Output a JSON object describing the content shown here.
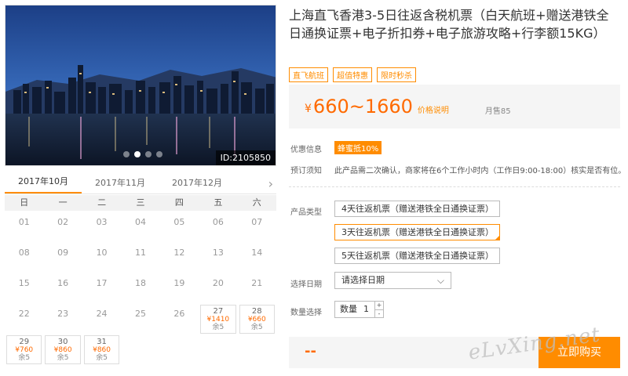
{
  "gallery": {
    "photo_id": "ID:2105850",
    "dots": [
      false,
      true,
      false,
      false
    ]
  },
  "calendar": {
    "months": [
      "2017年10月",
      "2017年11月",
      "2017年12月"
    ],
    "active_month": 0,
    "weekdays": [
      "日",
      "一",
      "二",
      "三",
      "四",
      "五",
      "六"
    ],
    "days": [
      {
        "day": "01"
      },
      {
        "day": "02"
      },
      {
        "day": "03"
      },
      {
        "day": "04"
      },
      {
        "day": "05"
      },
      {
        "day": "06"
      },
      {
        "day": "07"
      },
      {
        "day": "08"
      },
      {
        "day": "09"
      },
      {
        "day": "10"
      },
      {
        "day": "11"
      },
      {
        "day": "12"
      },
      {
        "day": "13"
      },
      {
        "day": "14"
      },
      {
        "day": "15"
      },
      {
        "day": "16"
      },
      {
        "day": "17"
      },
      {
        "day": "18"
      },
      {
        "day": "19"
      },
      {
        "day": "20"
      },
      {
        "day": "21"
      },
      {
        "day": "22"
      },
      {
        "day": "23"
      },
      {
        "day": "24"
      },
      {
        "day": "25"
      },
      {
        "day": "26"
      },
      {
        "day": "27",
        "price": "¥1410",
        "stock": "余5"
      },
      {
        "day": "28",
        "price": "¥660",
        "stock": "余5"
      },
      {
        "day": "29",
        "price": "¥760",
        "stock": "余5"
      },
      {
        "day": "30",
        "price": "¥860",
        "stock": "余5"
      },
      {
        "day": "31",
        "price": "¥860",
        "stock": "余5"
      }
    ]
  },
  "product": {
    "title": "上海直飞香港3-5日往返含税机票（白天航班+赠送港铁全日通换证票+电子折扣券+电子旅游攻略+行李额15KG）",
    "tags": [
      "直飞航班",
      "超值特惠",
      "限时秒杀"
    ],
    "currency": "¥",
    "price_range": "660~1660",
    "price_note": "价格说明",
    "monthly_sales": "月售85",
    "coupon_label": "优惠信息",
    "coupon_badge": "蜂蜜抵10%",
    "booking_label": "预订须知",
    "booking_text": "此产品需二次确认，商家将在6个工作小时内（工作日9:00-18:00）核实是否有位。",
    "type_label": "产品类型",
    "options": [
      "4天往返机票（赠送港铁全日通换证票）",
      "3天往返机票（赠送港铁全日通换证票）",
      "5天往返机票（赠送港铁全日通换证票）"
    ],
    "selected_option": 1,
    "date_label": "选择日期",
    "date_placeholder": "请选择日期",
    "qty_label": "数量选择",
    "qty_prefix": "数量",
    "qty_value": "1",
    "footer_price": "--",
    "buy_label": "立即购买",
    "watermark": "eLvXing.net"
  },
  "colors": {
    "accent": "#ff8c00",
    "price": "#ff6a00"
  }
}
